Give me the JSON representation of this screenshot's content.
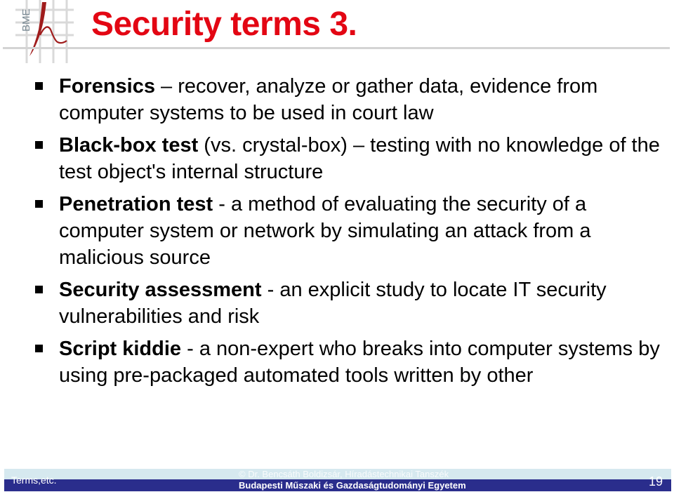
{
  "logo": {
    "text": "BME",
    "icon": "bme-h-logo-icon",
    "accent_color": "#a01c1c"
  },
  "slide": {
    "title": "Security terms 3.",
    "title_color": "#e30613",
    "bullets": [
      {
        "term": "Forensics",
        "definition": " – recover, analyze or gather data, evidence from computer systems to be used in court law"
      },
      {
        "term": "Black-box test",
        "definition": " (vs. crystal-box) – testing with no knowledge of the test object's internal structure"
      },
      {
        "term": "Penetration test",
        "definition": " - a method of evaluating the security of a computer system or network by simulating an attack from a malicious source"
      },
      {
        "term": "Security assessment",
        "definition": " -  an explicit study to locate IT security vulnerabilities and risk"
      },
      {
        "term": "Script kiddie",
        "definition": " - a non-expert who breaks into computer systems by using pre-packaged automated tools written by other"
      }
    ]
  },
  "footer": {
    "left_label": "Terms,etc.",
    "copyright": "© Dr. Bencsáth Boldizsár, Híradástechnikai Tanszék",
    "university": "Budapesti Műszaki és Gazdaságtudományi Egyetem",
    "page_number": "19",
    "band_color": "#2a2d8c"
  }
}
